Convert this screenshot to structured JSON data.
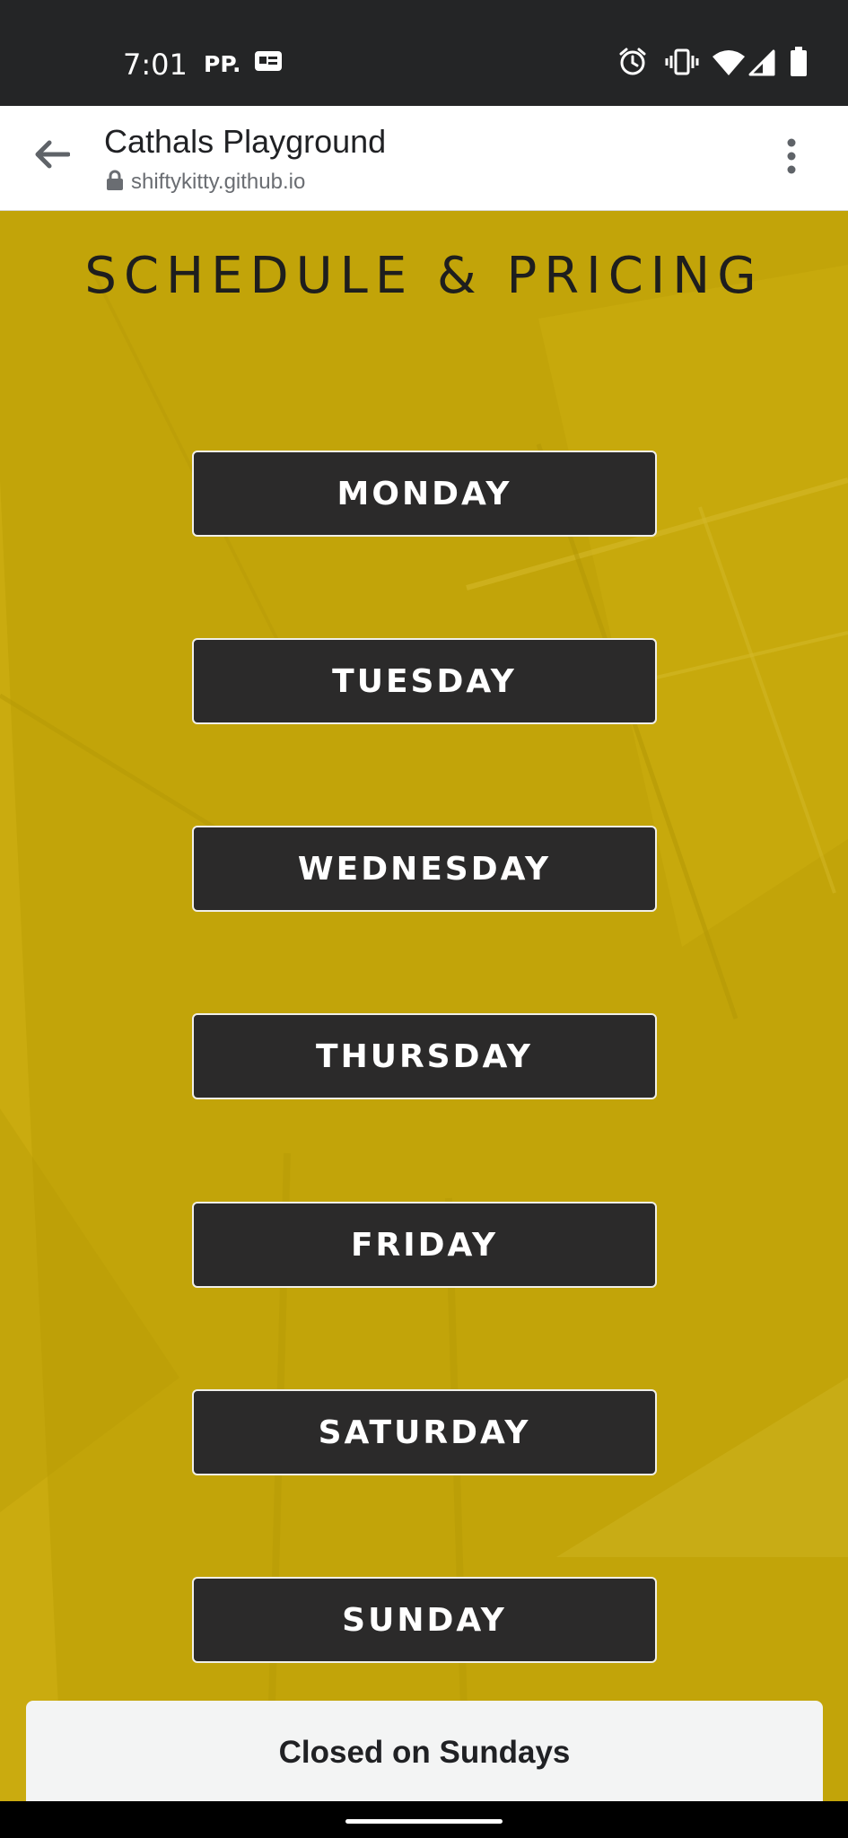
{
  "status_bar": {
    "time": "7:01",
    "carrier": "PP.",
    "icons": [
      "sim-card-icon",
      "alarm-icon",
      "vibrate-icon",
      "wifi-icon",
      "signal-icon",
      "battery-icon"
    ]
  },
  "browser": {
    "title": "Cathals Playground",
    "url": "shiftykitty.github.io",
    "back_icon": "back-arrow-icon",
    "lock_icon": "lock-icon",
    "menu_icon": "more-vert-icon"
  },
  "page": {
    "heading": "SCHEDULE & PRICING",
    "background_color": "#c2a409",
    "days": [
      "MONDAY",
      "TUESDAY",
      "WEDNESDAY",
      "THURSDAY",
      "FRIDAY",
      "SATURDAY",
      "SUNDAY"
    ]
  },
  "sheet": {
    "text": "Closed on Sundays"
  }
}
